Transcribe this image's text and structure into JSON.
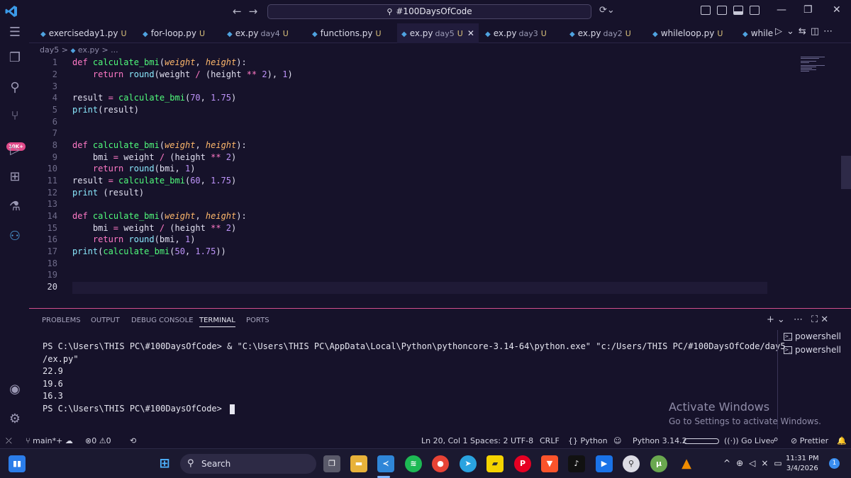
{
  "titlebar": {
    "search_text": "#100DaysOfCode"
  },
  "tabs": [
    {
      "name": "exerciseday1.py",
      "sub": "",
      "status": "U"
    },
    {
      "name": "for-loop.py",
      "sub": "",
      "status": "U"
    },
    {
      "name": "ex.py",
      "sub": "day4",
      "status": "U"
    },
    {
      "name": "functions.py",
      "sub": "",
      "status": "U"
    },
    {
      "name": "ex.py",
      "sub": "day5",
      "status": "U",
      "active": true
    },
    {
      "name": "ex.py",
      "sub": "day3",
      "status": "U"
    },
    {
      "name": "ex.py",
      "sub": "day2",
      "status": "U"
    },
    {
      "name": "whileloop.py",
      "sub": "",
      "status": "U"
    },
    {
      "name": "while",
      "sub": "",
      "status": ""
    }
  ],
  "activity": {
    "badge": "10K+"
  },
  "breadcrumb": {
    "folder": "day5",
    "file": "ex.py",
    "more": "..."
  },
  "editor": {
    "line_numbers": [
      "1",
      "2",
      "3",
      "4",
      "5",
      "6",
      "7",
      "8",
      "9",
      "10",
      "11",
      "12",
      "13",
      "14",
      "15",
      "16",
      "17",
      "18",
      "19",
      "20"
    ],
    "current_line": 20
  },
  "panel": {
    "tabs": [
      "PROBLEMS",
      "OUTPUT",
      "DEBUG CONSOLE",
      "TERMINAL",
      "PORTS"
    ],
    "active_tab": "TERMINAL",
    "terminal_lines": [
      "PS C:\\Users\\THIS PC\\#100DaysOfCode> & \"C:\\Users\\THIS PC\\AppData\\Local\\Python\\pythoncore-3.14-64\\python.exe\" \"c:/Users/THIS PC/#100DaysOfCode/day5",
      "/ex.py\"",
      "22.9",
      "19.6",
      "16.3",
      "PS C:\\Users\\THIS PC\\#100DaysOfCode> "
    ],
    "shells": [
      "powershell",
      "powershell"
    ],
    "watermark_title": "Activate Windows",
    "watermark_sub": "Go to Settings to activate Windows."
  },
  "statusbar": {
    "branch": "main*+",
    "errors": "0",
    "warnings": "0",
    "position": "Ln 20, Col 1",
    "spaces": "Spaces: 2",
    "encoding": "UTF-8",
    "eol": "CRLF",
    "language": "Python",
    "interpreter": "Python 3.14.2",
    "golive": "Go Live",
    "prettier": "Prettier"
  },
  "taskbar": {
    "search": "Search",
    "time": "11:31 PM",
    "date": "3/4/2026",
    "notifications": "1"
  }
}
